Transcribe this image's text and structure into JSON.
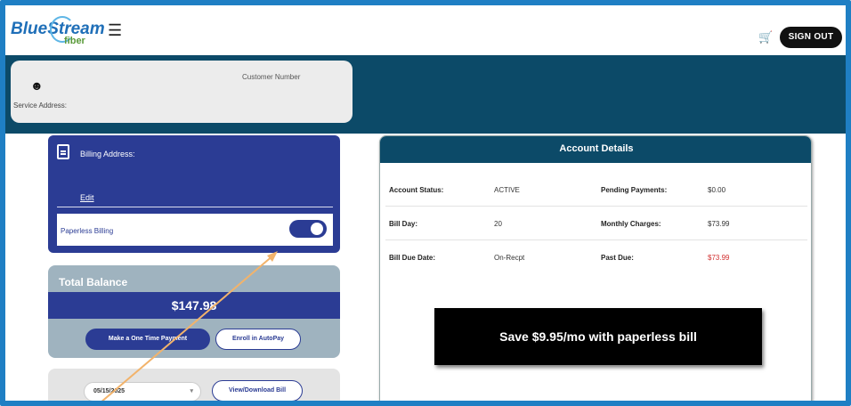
{
  "header": {
    "brand_blue": "Blue",
    "brand_stream": "Stream",
    "brand_fiber": "fiber",
    "menu_icon": "hamburger-icon",
    "cart_icon": "cart-icon",
    "signout_label": "SIGN OUT"
  },
  "customer": {
    "customer_number_label": "Customer Number",
    "service_address_label": "Service Address:",
    "avatar_icon": "user-icon"
  },
  "billing": {
    "billing_address_label": "Billing Address:",
    "edit_label": "Edit",
    "paperless_label": "Paperless Billing",
    "paperless_on": true
  },
  "balance": {
    "title": "Total Balance",
    "amount": "$147.98",
    "pay_label": "Make a One Time Payment",
    "autopay_label": "Enroll in AutoPay"
  },
  "bills": {
    "selected": "05/15/2025",
    "view_label": "View/Download Bill"
  },
  "account": {
    "title": "Account Details",
    "rows": [
      {
        "l1": "Account Status:",
        "v1": "ACTIVE",
        "l2": "Pending Payments:",
        "v2": "$0.00"
      },
      {
        "l1": "Bill Day:",
        "v1": "20",
        "l2": "Monthly Charges:",
        "v2": "$73.99"
      },
      {
        "l1": "Bill Due Date:",
        "v1": "On-Recpt",
        "l2": "Past Due:",
        "v2": "$73.99"
      }
    ],
    "promo": "Save $9.95/mo with paperless bill"
  },
  "colors": {
    "navy": "#0c4a68",
    "billing_blue": "#2b3c94",
    "past_due_red": "#d23030",
    "frame_blue": "#1f7fc4",
    "arrow_orange": "#f2b36b"
  }
}
